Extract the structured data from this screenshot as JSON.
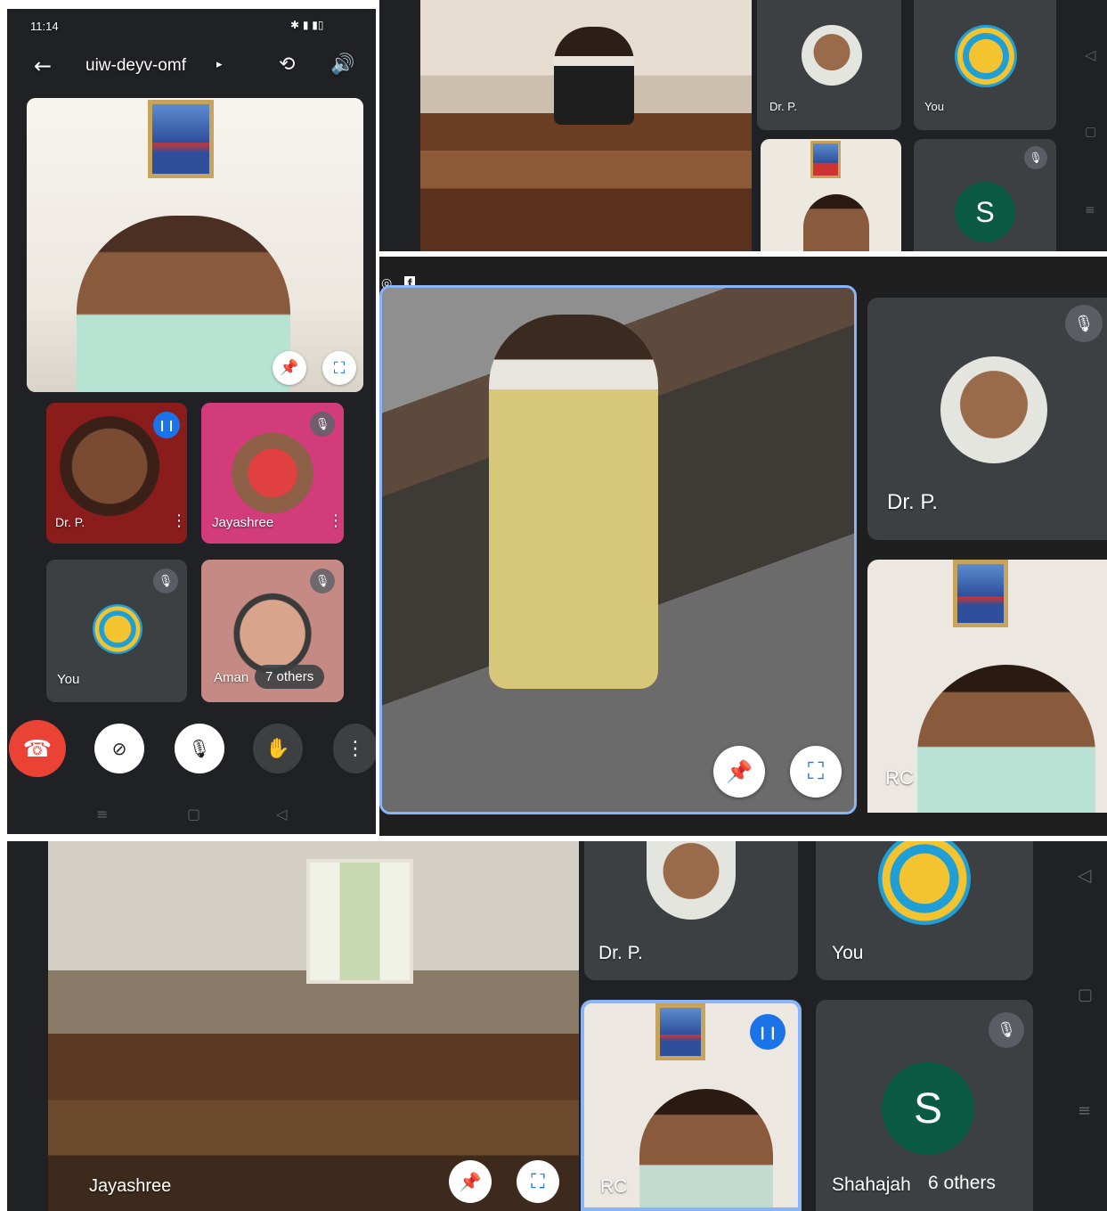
{
  "phone": {
    "status_time": "11:14",
    "meeting_code": "uiw-deyv-omf",
    "tiles": [
      {
        "name": "Dr. P."
      },
      {
        "name": "Jayashree"
      },
      {
        "name": "You"
      },
      {
        "name": "Aman"
      }
    ],
    "others_count": "7 others"
  },
  "tablet_top": {
    "tiles": [
      {
        "name": "Dr. P."
      },
      {
        "name": "You"
      },
      {
        "initial": "S"
      }
    ]
  },
  "tablet_mid": {
    "tiles": [
      {
        "name": "Dr. P."
      },
      {
        "name": "RC"
      }
    ]
  },
  "tablet_bottom": {
    "main_name": "Jayashree",
    "tiles": [
      {
        "name": "Dr. P."
      },
      {
        "name": "You"
      },
      {
        "name": "RC"
      },
      {
        "name": "Shahajah",
        "initial": "S"
      }
    ],
    "others_count": "6 others"
  },
  "colors": {
    "panel": "#202124",
    "tile": "#3c4043",
    "accent": "#1a73e8",
    "end_call": "#ea4335"
  }
}
